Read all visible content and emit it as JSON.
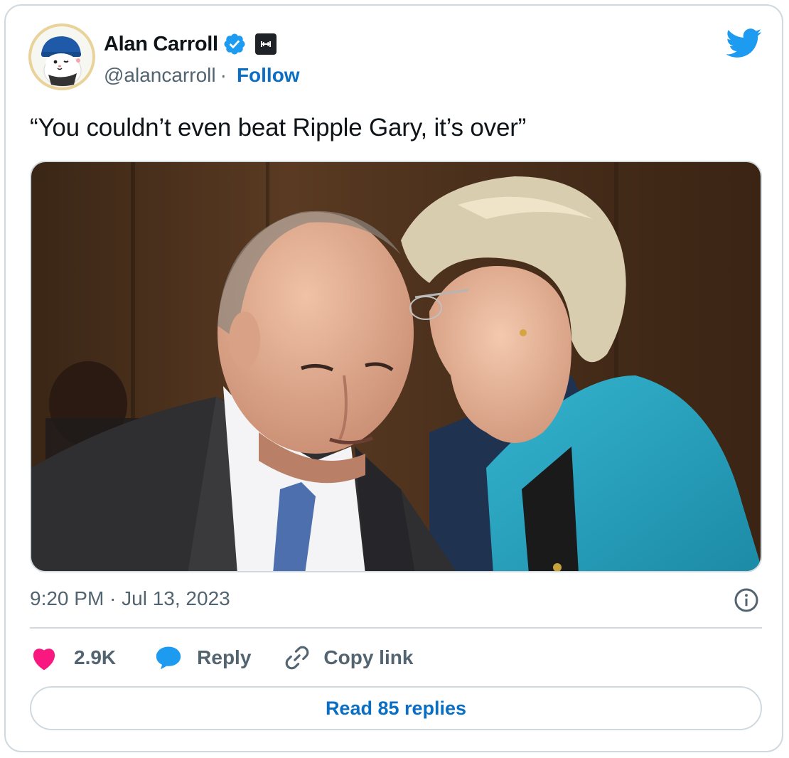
{
  "author": {
    "name": "Alan Carroll",
    "handle": "@alancarroll",
    "separator": "·",
    "follow_label": "Follow",
    "avatar_icon": "cartoon-seal-avatar",
    "verified_icon": "verified-badge-icon",
    "affiliate_icon": "affiliate-badge-icon"
  },
  "tweet": {
    "text": "“You couldn’t even beat Ripple Gary, it’s over”",
    "media_description": "photo",
    "timestamp": "9:20 PM · Jul 13, 2023"
  },
  "actions": {
    "likes": "2.9K",
    "reply_label": "Reply",
    "copy_link_label": "Copy link"
  },
  "read_replies_label": "Read 85 replies",
  "colors": {
    "accent": "#0a6fc4",
    "twitter_blue": "#1d9bf0",
    "like_pink": "#f91880",
    "muted_text": "#536471",
    "border": "#cfd9de"
  }
}
